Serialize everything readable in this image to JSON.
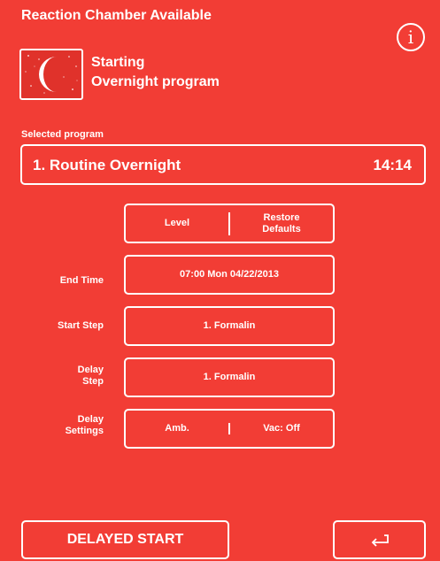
{
  "header": {
    "title": "Reaction Chamber Available",
    "info_symbol": "i"
  },
  "status": {
    "icon": "moon-night-icon",
    "line1": "Starting",
    "line2": "Overnight program"
  },
  "selected_program": {
    "label": "Selected program",
    "name": "1. Routine Overnight",
    "time": "14:14"
  },
  "buttons": {
    "level": "Level",
    "restore_line1": "Restore",
    "restore_line2": "Defaults"
  },
  "rows": {
    "end_time_label": "End Time",
    "end_time_value": "07:00  Mon 04/22/2013",
    "start_step_label": "Start Step",
    "start_step_value": "1. Formalin",
    "delay_step_label_1": "Delay",
    "delay_step_label_2": "Step",
    "delay_step_value": "1. Formalin",
    "delay_settings_label_1": "Delay",
    "delay_settings_label_2": "Settings",
    "delay_amb": "Amb.",
    "delay_vac": "Vac: Off"
  },
  "footer": {
    "delayed_start": "DELAYED START",
    "back_icon": "return-arrow-icon"
  }
}
